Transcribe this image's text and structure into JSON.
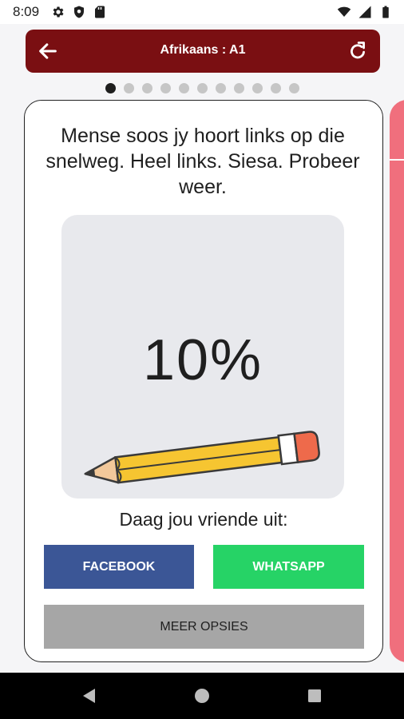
{
  "status_bar": {
    "time": "8:09",
    "left_icons": [
      "gear-icon",
      "shield-icon",
      "sd-card-icon"
    ],
    "right_icons": [
      "wifi-icon",
      "signal-icon",
      "battery-icon"
    ]
  },
  "app_bar": {
    "title": "Afrikaans : A1",
    "back_icon": "arrow-left-icon",
    "refresh_icon": "refresh-icon",
    "color": "#7a0f12"
  },
  "pager": {
    "total": 11,
    "active_index": 0
  },
  "result_card": {
    "message": "Mense soos jy hoort links op die snelweg. Heel links. Siesa. Probeer weer.",
    "score": "10%",
    "illustration": "pencil-icon",
    "challenge_text": "Daag jou vriende uit:"
  },
  "buttons": {
    "facebook": "FACEBOOK",
    "whatsapp": "WHATSAPP",
    "more_options": "MEER OPSIES"
  },
  "colors": {
    "facebook": "#3b5696",
    "whatsapp": "#26d366",
    "more": "#a6a6a6",
    "next_card": "#f06f7d"
  },
  "nav_bar": {
    "icons": [
      "back-triangle-icon",
      "home-circle-icon",
      "recents-square-icon"
    ]
  }
}
